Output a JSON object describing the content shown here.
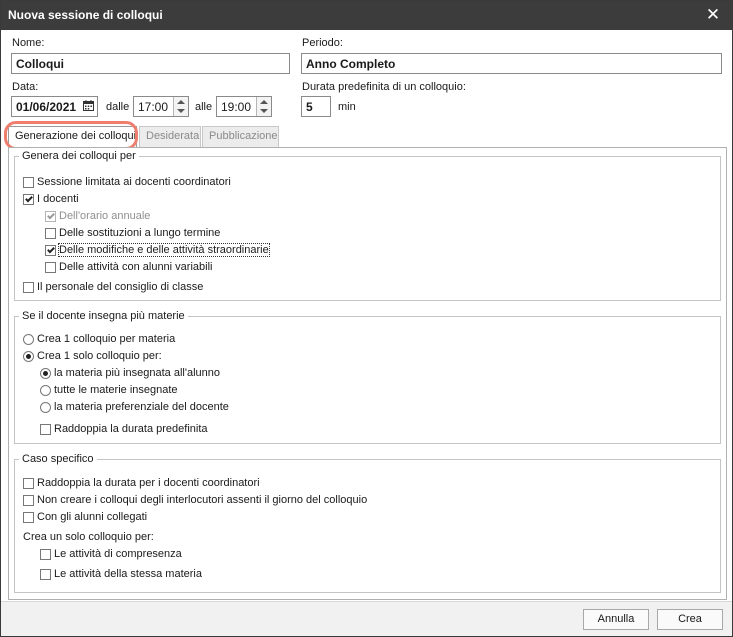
{
  "window": {
    "title": "Nuova sessione di colloqui",
    "close_icon": "close-icon"
  },
  "form": {
    "nome_label": "Nome:",
    "nome_value": "Colloqui",
    "periodo_label": "Periodo:",
    "periodo_value": "Anno Completo",
    "data_label": "Data:",
    "data_value": "01/06/2021",
    "dalle_label": "dalle",
    "dalle_value": "17:00",
    "alle_label": "alle",
    "alle_value": "19:00",
    "durata_label": "Durata predefinita di un colloquio:",
    "durata_value": "5",
    "durata_unit": "min"
  },
  "tabs": [
    {
      "label": "Generazione dei colloqui",
      "active": true
    },
    {
      "label": "Desiderata",
      "active": false
    },
    {
      "label": "Pubblicazione",
      "active": false
    }
  ],
  "group1": {
    "legend": "Genera dei colloqui per",
    "items": [
      {
        "label": "Sessione limitata ai docenti coordinatori",
        "checked": false,
        "disabled": false
      },
      {
        "label": "I docenti",
        "checked": true,
        "disabled": false
      },
      {
        "label": "Dell'orario annuale",
        "checked": true,
        "disabled": true
      },
      {
        "label": "Delle sostituzioni a lungo termine",
        "checked": false,
        "disabled": false
      },
      {
        "label": "Delle modifiche e delle attività straordinarie",
        "checked": true,
        "disabled": false
      },
      {
        "label": "Delle attività con alunni variabili",
        "checked": false,
        "disabled": false
      },
      {
        "label": "Il personale del consiglio di classe",
        "checked": false,
        "disabled": false
      }
    ]
  },
  "group2": {
    "legend": "Se il docente insegna più materie",
    "radio_main": [
      {
        "label": "Crea 1 colloquio per materia",
        "selected": false
      },
      {
        "label": "Crea 1 solo colloquio per:",
        "selected": true
      }
    ],
    "radio_sub": [
      {
        "label": "la materia più insegnata all'alunno",
        "selected": true
      },
      {
        "label": "tutte le materie insegnate",
        "selected": false
      },
      {
        "label": "la materia preferenziale del docente",
        "selected": false
      }
    ],
    "double_label": "Raddoppia la durata predefinita",
    "double_checked": false
  },
  "group3": {
    "legend": "Caso specifico",
    "items": [
      {
        "label": "Raddoppia la durata per i docenti coordinatori",
        "checked": false
      },
      {
        "label": "Non creare i colloqui degli interlocutori assenti il giorno del colloquio",
        "checked": false
      },
      {
        "label": "Con gli alunni collegati",
        "checked": false
      }
    ],
    "sub_heading": "Crea un solo colloquio per:",
    "sub_items": [
      {
        "label": "Le attività di compresenza",
        "checked": false
      },
      {
        "label": "Le attività della stessa materia",
        "checked": false
      }
    ]
  },
  "buttons": {
    "cancel": "Annulla",
    "create": "Crea"
  },
  "colors": {
    "titlebar": "#3c3c3c",
    "tab_highlight": "#f07e6e"
  }
}
